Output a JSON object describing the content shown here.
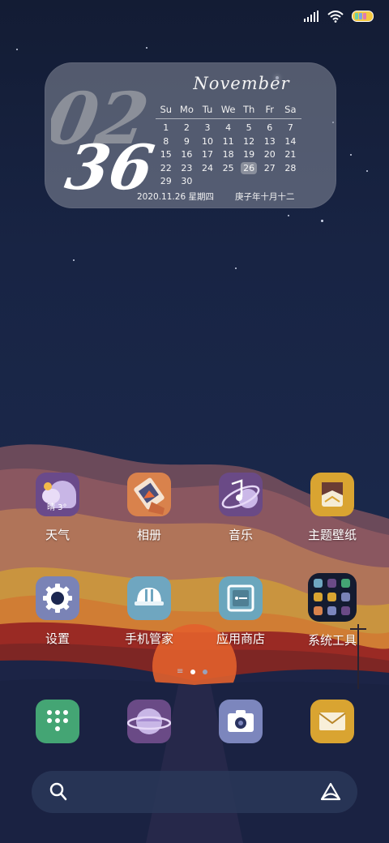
{
  "status_bar": {
    "icons": [
      "signal-icon",
      "wifi-icon",
      "battery-icon"
    ]
  },
  "widget": {
    "time_hours": "02",
    "time_minutes": "36",
    "month": "November",
    "weekdays": [
      "Su",
      "Mo",
      "Tu",
      "We",
      "Th",
      "Fr",
      "Sa"
    ],
    "weeks": [
      [
        "1",
        "2",
        "3",
        "4",
        "5",
        "6",
        "7"
      ],
      [
        "8",
        "9",
        "10",
        "11",
        "12",
        "13",
        "14"
      ],
      [
        "15",
        "16",
        "17",
        "18",
        "19",
        "20",
        "21"
      ],
      [
        "22",
        "23",
        "24",
        "25",
        "26",
        "27",
        "28"
      ],
      [
        "29",
        "30",
        "",
        "",
        "",
        "",
        ""
      ]
    ],
    "today": "26",
    "date_text": "2020.11.26 星期四",
    "lunar_text": "庚子年十月十二"
  },
  "apps": {
    "weather": {
      "label": "天气",
      "temp": "晴 3°"
    },
    "gallery": {
      "label": "相册"
    },
    "music": {
      "label": "音乐"
    },
    "themes": {
      "label": "主题壁纸"
    },
    "settings": {
      "label": "设置"
    },
    "security": {
      "label": "手机管家"
    },
    "appstore": {
      "label": "应用商店"
    },
    "tools": {
      "label": "系统工具"
    }
  },
  "page_indicator": {
    "pages": 2,
    "current": 1
  },
  "dock": {
    "icons": [
      "dialer-icon",
      "browser-icon",
      "camera-icon",
      "messages-icon"
    ]
  },
  "search": {
    "icons": [
      "search-icon",
      "assistant-icon"
    ]
  },
  "colors": {
    "weather": "#6a4a8a",
    "gallery": "#d9824c",
    "music": "#6a4a86",
    "themes": "#d9a431",
    "settings": "#7a83b6",
    "security": "#6fa6c0",
    "appstore": "#6ba6bd",
    "tools_bg": "#141b30",
    "dialer": "#44a574",
    "browser": "#6a4a86",
    "camera": "#7c86bd",
    "messages": "#d9a431"
  }
}
